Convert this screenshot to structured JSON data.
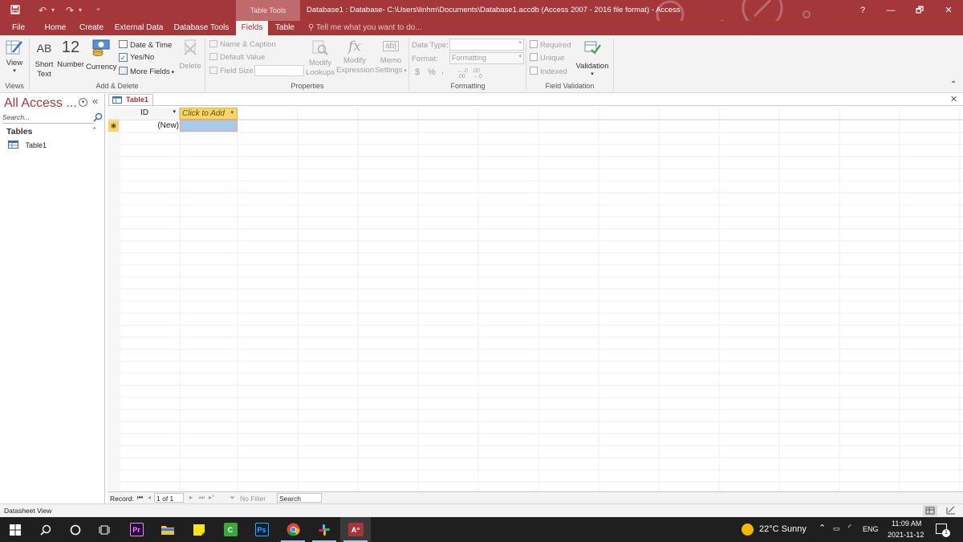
{
  "titlebar": {
    "context_tab": "Table Tools",
    "title": "Database1 : Database- C:\\Users\\linhm\\Documents\\Database1.accdb (Access 2007 - 2016 file format) - Access",
    "help": "?",
    "minimize": "—",
    "restore": "🗗",
    "close": "✕"
  },
  "tabs": {
    "file": "File",
    "home": "Home",
    "create": "Create",
    "external_data": "External Data",
    "database_tools": "Database Tools",
    "fields": "Fields",
    "table": "Table",
    "tell_me": "Tell me what you want to do..."
  },
  "ribbon": {
    "views": {
      "view": "View",
      "group": "Views"
    },
    "add_delete": {
      "short_text_glyph": "AB",
      "short_text_l1": "Short",
      "short_text_l2": "Text",
      "number_glyph": "12",
      "number": "Number",
      "currency": "Currency",
      "date_time": "Date & Time",
      "yes_no": "Yes/No",
      "more_fields": "More Fields",
      "delete": "Delete",
      "group": "Add & Delete"
    },
    "properties": {
      "name_caption": "Name & Caption",
      "default_value": "Default Value",
      "field_size": "Field Size",
      "modify_lookups_l1": "Modify",
      "modify_lookups_l2": "Lookups",
      "modify_expression_l1": "Modify",
      "modify_expression_l2": "Expression",
      "memo_settings_l1": "Memo",
      "memo_settings_l2": "Settings",
      "fx_glyph": "fx",
      "abl_glyph": "ab|",
      "group": "Properties"
    },
    "formatting": {
      "data_type": "Data Type:",
      "format": "Format:",
      "format_value": "Formatting",
      "dollar": "$",
      "percent": "%",
      "comma": ",",
      "group": "Formatting"
    },
    "field_validation": {
      "required": "Required",
      "unique": "Unique",
      "indexed": "Indexed",
      "validation": "Validation",
      "group": "Field Validation"
    }
  },
  "nav": {
    "title": "All Access ...",
    "search_placeholder": "Search...",
    "group": "Tables",
    "items": [
      {
        "label": "Table1"
      }
    ]
  },
  "document": {
    "tab": "Table1",
    "columns": {
      "id": "ID",
      "click_to_add": "Click to Add"
    },
    "new_row": {
      "marker": "✱",
      "id_value": "(New)"
    }
  },
  "record_nav": {
    "label": "Record:",
    "position": "1 of 1",
    "filter": "No Filter",
    "search": "Search"
  },
  "statusbar": {
    "view": "Datasheet View"
  },
  "taskbar": {
    "apps": [
      "Pr",
      "Ps",
      "A"
    ],
    "weather": "22°C  Sunny",
    "lang": "ENG",
    "time": "11:09 AM",
    "date": "2021-11-12",
    "notifications": "1"
  },
  "colors": {
    "access_red": "#a4373a",
    "header_yellow": "#f7d56e",
    "selected_cell": "#a9cbeb"
  }
}
